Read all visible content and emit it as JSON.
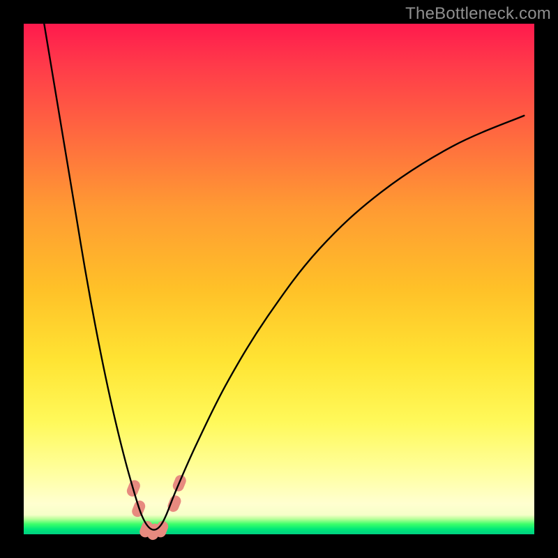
{
  "watermark": {
    "text": "TheBottleneck.com"
  },
  "chart_data": {
    "type": "line",
    "title": "",
    "xlabel": "",
    "ylabel": "",
    "xlim": [
      0,
      100
    ],
    "ylim": [
      0,
      100
    ],
    "grid": false,
    "series": [
      {
        "name": "bottleneck-curve",
        "x": [
          4,
          6,
          8,
          10,
          12,
          14,
          16,
          18,
          20,
          22,
          23,
          24,
          25,
          26,
          27,
          28,
          30,
          34,
          40,
          48,
          58,
          70,
          84,
          98
        ],
        "values": [
          100,
          88,
          76,
          64,
          52,
          41,
          31,
          22,
          14,
          7,
          4,
          2,
          1,
          1,
          2,
          4,
          9,
          18,
          30,
          43,
          56,
          67,
          76,
          82
        ]
      }
    ],
    "markers": [
      {
        "name": "marker-left-upper",
        "x": 21.5,
        "y": 9,
        "color": "#e78a7f"
      },
      {
        "name": "marker-left-lower",
        "x": 22.5,
        "y": 5,
        "color": "#e78a7f"
      },
      {
        "name": "marker-bottom-1",
        "x": 24,
        "y": 1,
        "color": "#e78a7f"
      },
      {
        "name": "marker-bottom-2",
        "x": 25.5,
        "y": 0.5,
        "color": "#e78a7f"
      },
      {
        "name": "marker-bottom-3",
        "x": 27,
        "y": 1,
        "color": "#e78a7f"
      },
      {
        "name": "marker-right-lower",
        "x": 29.5,
        "y": 6,
        "color": "#e78a7f"
      },
      {
        "name": "marker-right-upper",
        "x": 30.5,
        "y": 10,
        "color": "#e78a7f"
      }
    ]
  }
}
